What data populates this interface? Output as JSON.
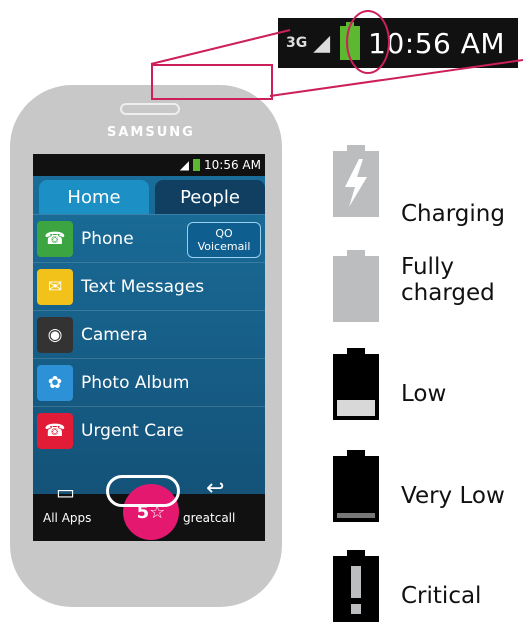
{
  "zoom_status": {
    "network": "3G",
    "time": "10:56 AM"
  },
  "phone": {
    "brand": "SAMSUNG",
    "status_time": "10:56 AM",
    "tabs": [
      "Home",
      "People"
    ],
    "apps": [
      {
        "label": "Phone",
        "icon": "phone-icon",
        "color": "#3ca542"
      },
      {
        "label": "Text Messages",
        "icon": "envelope-icon",
        "color": "#f3c21a"
      },
      {
        "label": "Camera",
        "icon": "camera-icon",
        "color": "#333333"
      },
      {
        "label": "Photo Album",
        "icon": "flower-icon",
        "color": "#2c91d6"
      },
      {
        "label": "Urgent Care",
        "icon": "urgent-care-icon",
        "color": "#e21c36"
      }
    ],
    "voicemail_label": "Voicemail",
    "voicemail_symbol": "QO",
    "all_apps_label": "All Apps",
    "five_star_label": "5☆",
    "greatcall_label": "greatcall"
  },
  "legend": [
    {
      "label": "Charging",
      "icon": "battery-charging-icon"
    },
    {
      "label": "Fully charged",
      "icon": "battery-full-icon"
    },
    {
      "label": "Low",
      "icon": "battery-low-icon"
    },
    {
      "label": "Very Low",
      "icon": "battery-very-low-icon"
    },
    {
      "label": "Critical",
      "icon": "battery-critical-icon"
    }
  ],
  "colors": {
    "highlight": "#cc1f5c",
    "battery_green": "#5cb82f",
    "battery_gray": "#bcbdbf"
  }
}
